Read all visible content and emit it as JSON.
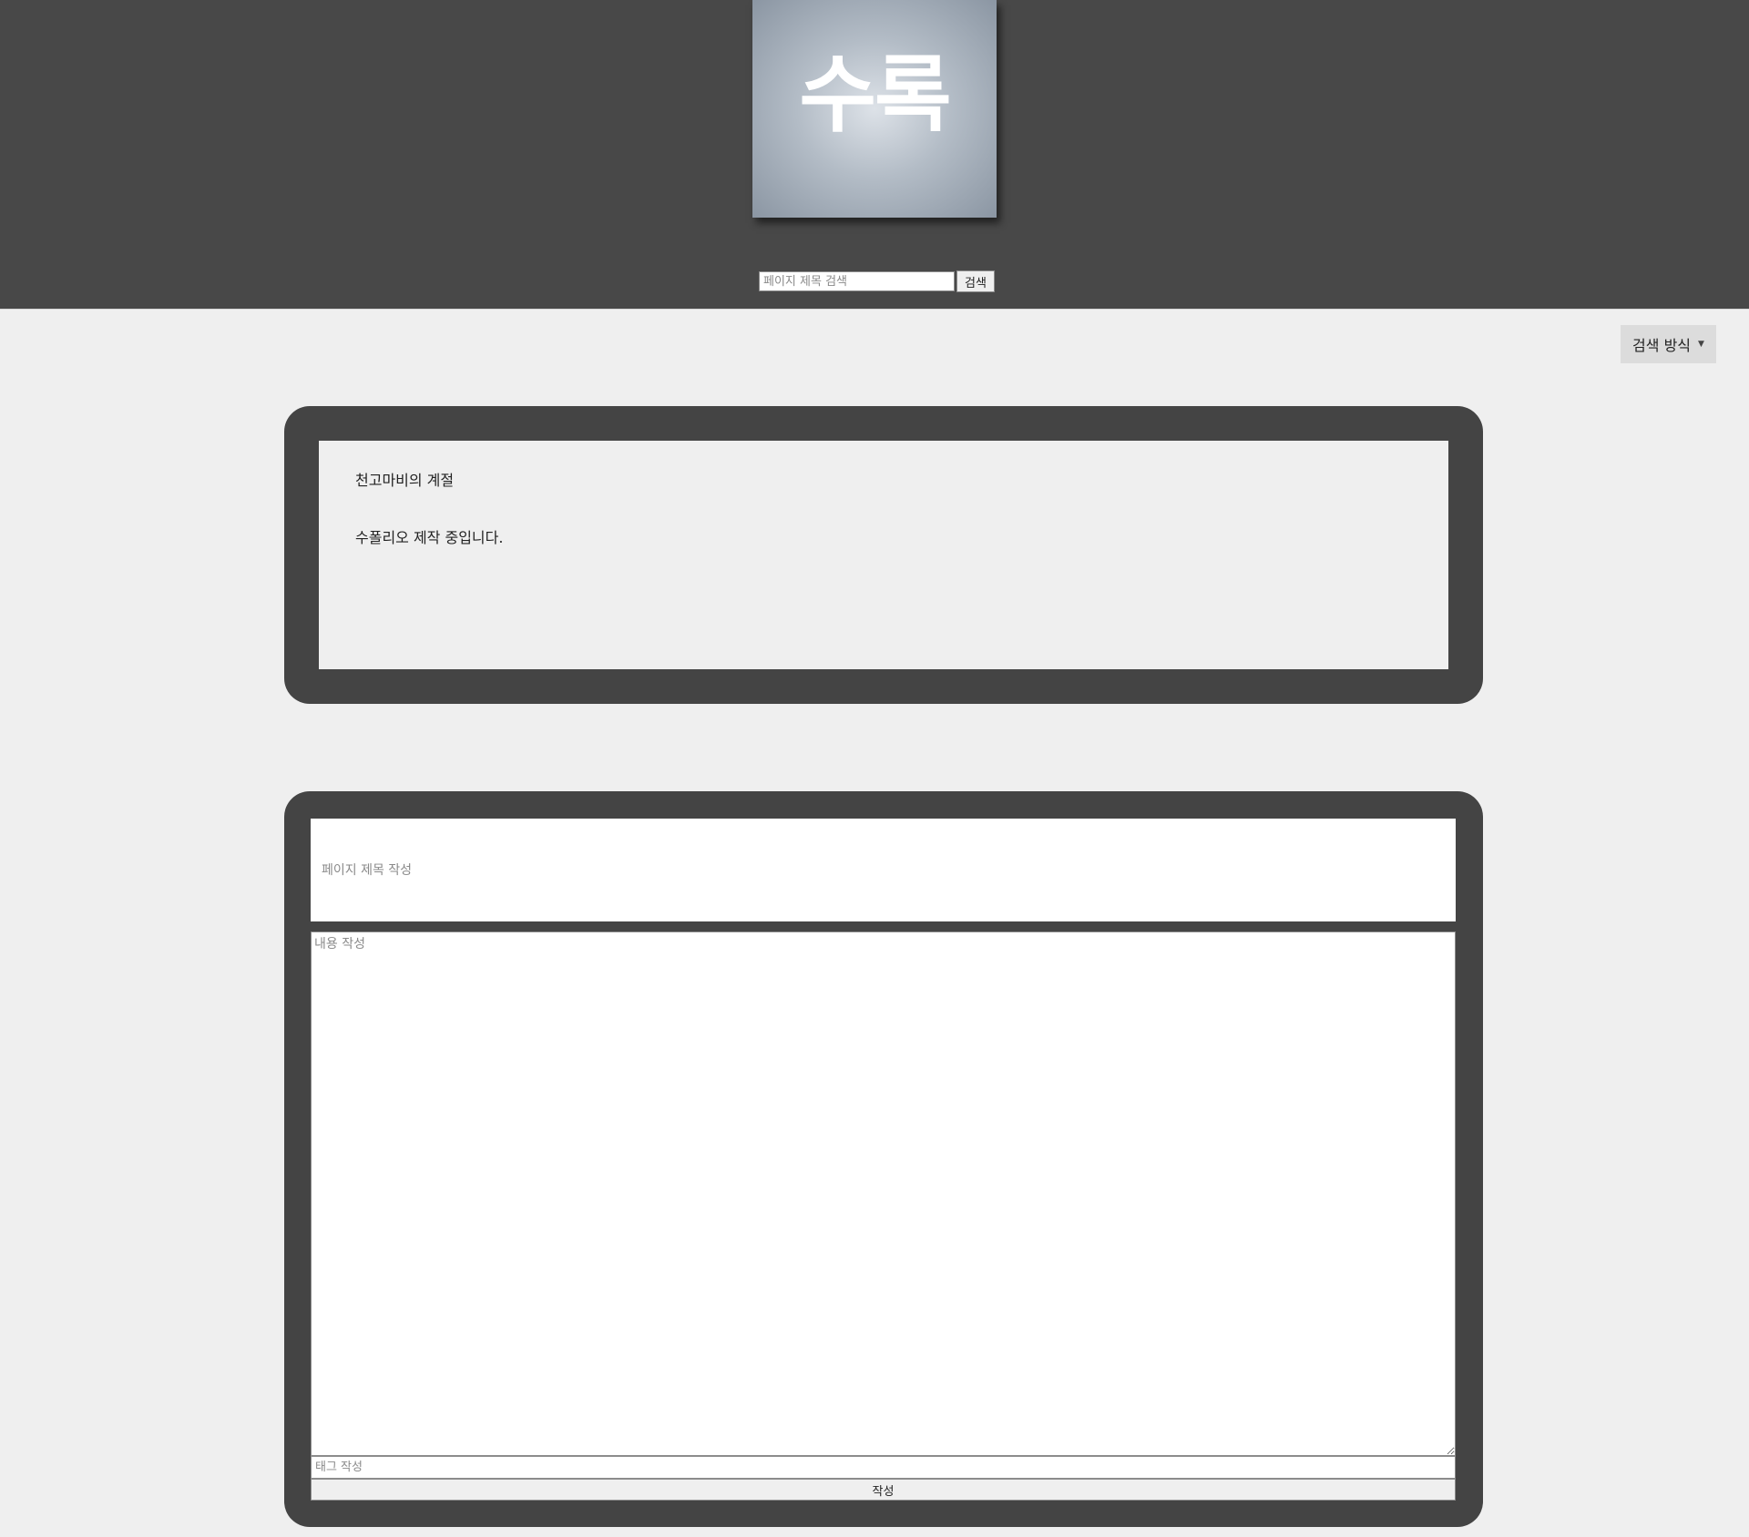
{
  "header": {
    "logo_text": "수록",
    "search": {
      "placeholder": "페이지 제목 검색",
      "value": "",
      "button_label": "검색"
    }
  },
  "search_mode": {
    "label": "검색 방식",
    "icon": "caret-down-icon"
  },
  "notice": {
    "title": "천고마비의 계절",
    "body": "수폴리오 제작 중입니다."
  },
  "write_form": {
    "title_placeholder": "페이지 제목 작성",
    "content_placeholder": "내용 작성",
    "tag_placeholder": "태그 작성",
    "submit_label": "작성"
  },
  "colors": {
    "header_bg": "#484848",
    "panel_bg": "#444444",
    "page_bg": "#efefef",
    "dropdown_bg": "#dcdcdc"
  }
}
